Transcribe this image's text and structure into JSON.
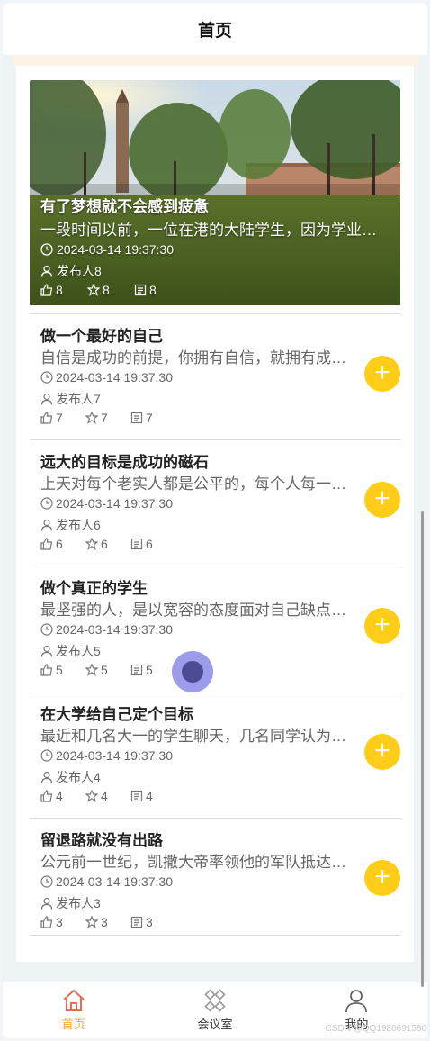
{
  "header": {
    "title": "首页"
  },
  "banner": {
    "title": "有了梦想就不会感到疲惫",
    "summary": "一段时间以前，一位在港的大陆学生，因为学业压力",
    "time": "2024-03-14 19:37:30",
    "author": "发布人8",
    "likes": "8",
    "favorites": "8",
    "views": "8"
  },
  "articles": [
    {
      "title": "做一个最好的自己",
      "summary": "自信是成功的前提，你拥有自信，就拥有成功的开始",
      "time": "2024-03-14 19:37:30",
      "author": "发布人7",
      "likes": "7",
      "favorites": "7",
      "views": "7"
    },
    {
      "title": "远大的目标是成功的磁石",
      "summary": "上天对每个老实人都是公平的，每个人每一天都",
      "time": "2024-03-14 19:37:30",
      "author": "发布人6",
      "likes": "6",
      "favorites": "6",
      "views": "6"
    },
    {
      "title": "做个真正的学生",
      "summary": "最坚强的人，是以宽容的态度面对自己缺点的人",
      "time": "2024-03-14 19:37:30",
      "author": "发布人5",
      "likes": "5",
      "favorites": "5",
      "views": "5"
    },
    {
      "title": "在大学给自己定个目标",
      "summary": "最近和几名大一的学生聊天，几名同学认为大学",
      "time": "2024-03-14 19:37:30",
      "author": "发布人4",
      "likes": "4",
      "favorites": "4",
      "views": "4"
    },
    {
      "title": "留退路就没有出路",
      "summary": "公元前一世纪，凯撒大帝率领他的军队抵达英格兰",
      "time": "2024-03-14 19:37:30",
      "author": "发布人3",
      "likes": "3",
      "favorites": "3",
      "views": "3"
    }
  ],
  "add_button": {
    "symbol": "+"
  },
  "tabbar": {
    "items": [
      {
        "label": "首页",
        "icon": "home-icon",
        "active": true
      },
      {
        "label": "会议室",
        "icon": "meeting-room-icon",
        "active": false
      },
      {
        "label": "我的",
        "icon": "user-icon",
        "active": false
      }
    ]
  },
  "watermark": "CSDN @QQ1980691580",
  "colors": {
    "accent": "#fecd1a",
    "active_tab": "#f3a72c",
    "home_icon": "#e86b5a"
  }
}
